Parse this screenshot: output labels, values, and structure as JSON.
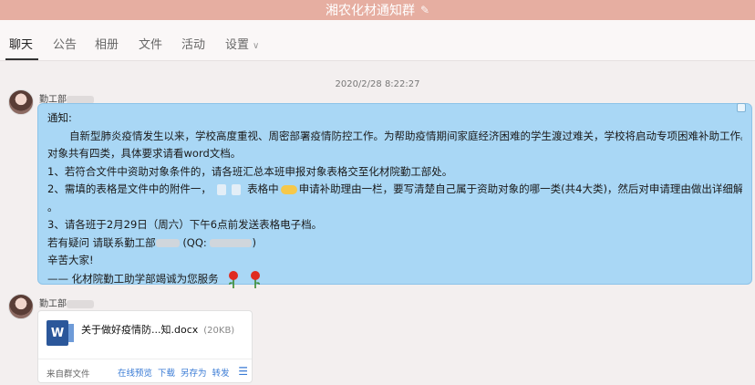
{
  "window": {
    "title": "湘农化材通知群",
    "edit_icon": "pencil-icon"
  },
  "tabs": [
    {
      "label": "聊天"
    },
    {
      "label": "公告"
    },
    {
      "label": "相册"
    },
    {
      "label": "文件"
    },
    {
      "label": "活动"
    },
    {
      "label": "设置"
    }
  ],
  "chat": {
    "timestamp": "2020/2/28 8:22:27",
    "messages": [
      {
        "sender": "勤工部",
        "lines": [
          "通知:",
          "自新型肺炎疫情发生以来，学校高度重视、周密部署疫情防控工作。为帮助疫情期间家庭经济困难的学生渡过难关，学校将启动专项困难补助工作。资助",
          "对象共有四类，具体要求请看word文档。",
          "1、若符合文件中资助对象条件的，请各班汇总本班申报对象表格交至化材院勤工部处。",
          "2、需填的表格是文件中的附件一，",
          "表格中",
          "申请补助理由一栏，要写清楚自己属于资助对象的哪一类(共4大类)，然后对申请理由做出详细解释",
          "。",
          "3、请各班于2月29日（周六）下午6点前发送表格电子档。",
          "若有疑问 请联系勤工部",
          "(QQ:",
          ")",
          "辛苦大家!",
          "—— 化材院勤工助学部竭诚为您服务"
        ]
      },
      {
        "sender": "勤工部",
        "file": {
          "name": "关于做好疫情防...知.docx",
          "size": "(20KB)",
          "icon_letter": "W",
          "source": "来自群文件",
          "actions": [
            "在线预览",
            "下载",
            "另存为",
            "转发"
          ]
        }
      }
    ]
  },
  "colors": {
    "title_bar": "#e6aea1",
    "bubble": "#a9d7f5",
    "link": "#3a7bd5"
  }
}
